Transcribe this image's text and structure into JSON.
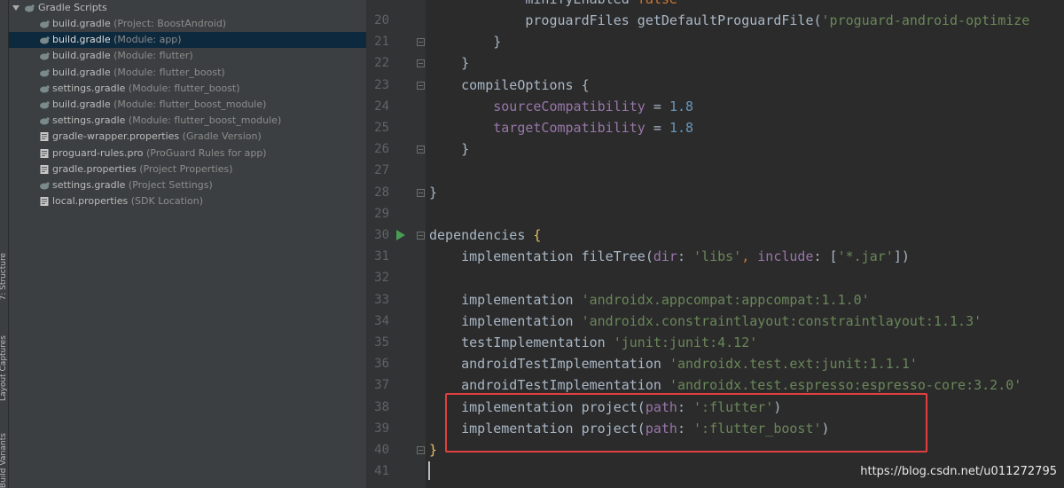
{
  "tool_window_labels": {
    "structure": "7: Structure",
    "layout_captures": "Layout Captures",
    "build_variants": "Build Variants"
  },
  "project_tree": {
    "root_label": "Gradle Scripts",
    "items": [
      {
        "name": "build.gradle",
        "hint": "(Project: BoostAndroid)",
        "icon": "gradle-icon"
      },
      {
        "name": "build.gradle",
        "hint": "(Module: app)",
        "icon": "gradle-icon",
        "selected": true
      },
      {
        "name": "build.gradle",
        "hint": "(Module: flutter)",
        "icon": "gradle-icon"
      },
      {
        "name": "build.gradle",
        "hint": "(Module: flutter_boost)",
        "icon": "gradle-icon"
      },
      {
        "name": "settings.gradle",
        "hint": "(Module: flutter_boost)",
        "icon": "gradle-icon"
      },
      {
        "name": "build.gradle",
        "hint": "(Module: flutter_boost_module)",
        "icon": "gradle-icon"
      },
      {
        "name": "settings.gradle",
        "hint": "(Module: flutter_boost_module)",
        "icon": "gradle-icon"
      },
      {
        "name": "gradle-wrapper.properties",
        "hint": "(Gradle Version)",
        "icon": "properties-icon"
      },
      {
        "name": "proguard-rules.pro",
        "hint": "(ProGuard Rules for app)",
        "icon": "properties-icon"
      },
      {
        "name": "gradle.properties",
        "hint": "(Project Properties)",
        "icon": "properties-icon"
      },
      {
        "name": "settings.gradle",
        "hint": "(Project Settings)",
        "icon": "gradle-icon"
      },
      {
        "name": "local.properties",
        "hint": "(SDK Location)",
        "icon": "properties-icon"
      }
    ]
  },
  "editor": {
    "line_numbers": [
      "20",
      "21",
      "22",
      "23",
      "24",
      "25",
      "26",
      "27",
      "28",
      "29",
      "30",
      "31",
      "32",
      "33",
      "34",
      "35",
      "36",
      "37",
      "38",
      "39",
      "40",
      "41"
    ],
    "partial_top_line": "minifyEnabled false",
    "lines": [
      [
        {
          "t": "            proguardFiles getDefaultProguardFile(",
          "c": "plain"
        },
        {
          "t": "'proguard-android-optimize",
          "c": "str"
        }
      ],
      [
        {
          "t": "        }",
          "c": "plain"
        }
      ],
      [
        {
          "t": "    }",
          "c": "plain"
        }
      ],
      [
        {
          "t": "    compileOptions {",
          "c": "plain"
        }
      ],
      [
        {
          "t": "        ",
          "c": "plain"
        },
        {
          "t": "sourceCompatibility",
          "c": "prop"
        },
        {
          "t": " = ",
          "c": "plain"
        },
        {
          "t": "1.8",
          "c": "num"
        }
      ],
      [
        {
          "t": "        ",
          "c": "plain"
        },
        {
          "t": "targetCompatibility",
          "c": "prop"
        },
        {
          "t": " = ",
          "c": "plain"
        },
        {
          "t": "1.8",
          "c": "num"
        }
      ],
      [
        {
          "t": "    }",
          "c": "plain"
        }
      ],
      [
        {
          "t": "",
          "c": "plain"
        }
      ],
      [
        {
          "t": "}",
          "c": "plain"
        }
      ],
      [
        {
          "t": "",
          "c": "plain"
        }
      ],
      [
        {
          "t": "dependencies ",
          "c": "plain"
        },
        {
          "t": "{",
          "c": "brace"
        }
      ],
      [
        {
          "t": "    implementation fileTree(",
          "c": "plain"
        },
        {
          "t": "dir",
          "c": "prop"
        },
        {
          "t": ": ",
          "c": "plain"
        },
        {
          "t": "'libs'",
          "c": "str"
        },
        {
          "t": ", ",
          "c": "kw"
        },
        {
          "t": "include",
          "c": "prop"
        },
        {
          "t": ": [",
          "c": "plain"
        },
        {
          "t": "'*.jar'",
          "c": "str"
        },
        {
          "t": "])",
          "c": "plain"
        }
      ],
      [
        {
          "t": "",
          "c": "plain"
        }
      ],
      [
        {
          "t": "    implementation ",
          "c": "plain"
        },
        {
          "t": "'androidx.appcompat:appcompat:1.1.0'",
          "c": "str"
        }
      ],
      [
        {
          "t": "    implementation ",
          "c": "plain"
        },
        {
          "t": "'androidx.constraintlayout:constraintlayout:1.1.3'",
          "c": "str"
        }
      ],
      [
        {
          "t": "    testImplementation ",
          "c": "plain"
        },
        {
          "t": "'junit:junit:4.12'",
          "c": "str"
        }
      ],
      [
        {
          "t": "    androidTestImplementation ",
          "c": "plain"
        },
        {
          "t": "'androidx.test.ext:junit:1.1.1'",
          "c": "str"
        }
      ],
      [
        {
          "t": "    androidTestImplementation ",
          "c": "plain"
        },
        {
          "t": "'androidx.test.espresso:espresso-core:3.2.0'",
          "c": "str"
        }
      ],
      [
        {
          "t": "    implementation project(",
          "c": "plain"
        },
        {
          "t": "path",
          "c": "prop"
        },
        {
          "t": ": ",
          "c": "plain"
        },
        {
          "t": "':flutter'",
          "c": "str"
        },
        {
          "t": ")",
          "c": "plain"
        }
      ],
      [
        {
          "t": "    implementation project(",
          "c": "plain"
        },
        {
          "t": "path",
          "c": "prop"
        },
        {
          "t": ": ",
          "c": "plain"
        },
        {
          "t": "':flutter_boost'",
          "c": "str"
        },
        {
          "t": ")",
          "c": "plain"
        }
      ],
      [
        {
          "t": "}",
          "c": "brace"
        }
      ],
      [
        {
          "t": "",
          "c": "plain"
        }
      ]
    ]
  },
  "watermark": "https://blog.csdn.net/u011272795",
  "colors": {
    "editor_bg": "#2b2b2b",
    "gutter_bg": "#313335",
    "panel_bg": "#3c3f41",
    "selection_bg": "#0d293e",
    "string": "#6a8759",
    "number": "#6897bb",
    "property": "#9876aa",
    "highlight_box": "#e0403f"
  }
}
